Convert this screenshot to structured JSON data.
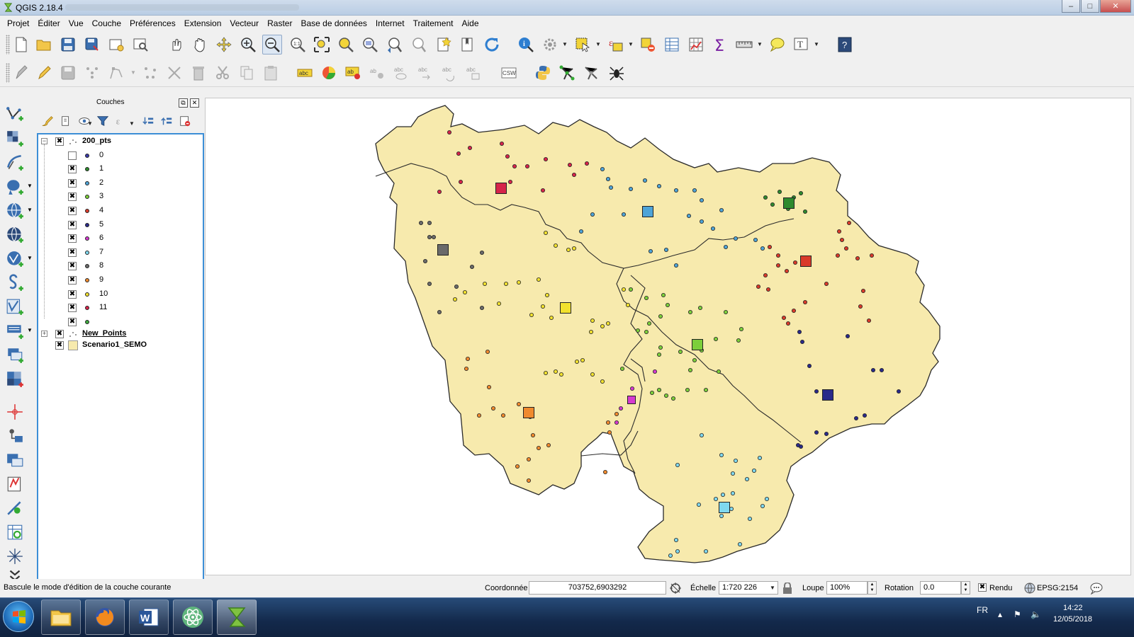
{
  "window": {
    "title": "QGIS 2.18.4",
    "min_label": "–",
    "max_label": "□",
    "close_label": "✕"
  },
  "menu": [
    "Projet",
    "Éditer",
    "Vue",
    "Couche",
    "Préférences",
    "Extension",
    "Vecteur",
    "Raster",
    "Base de données",
    "Internet",
    "Traitement",
    "Aide"
  ],
  "toolbar1": [
    "new-project-icon",
    "open-project-icon",
    "save-project-icon",
    "save-as-icon",
    "new-print-composer-icon",
    "composer-manager-icon",
    "touch-pan-icon",
    "pan-icon",
    "pan-to-selection-icon",
    "zoom-in-icon",
    "zoom-out-icon",
    "zoom-native-icon",
    "zoom-full-icon",
    "zoom-to-selection-icon",
    "zoom-to-layer-icon",
    "zoom-last-icon",
    "zoom-next-icon",
    "new-bookmark-icon",
    "show-bookmarks-icon",
    "refresh-icon",
    "identify-icon",
    "run-action-icon",
    "select-features-icon",
    "select-by-expression-icon",
    "deselect-icon",
    "attribute-table-icon",
    "field-calculator-icon",
    "statistics-icon",
    "measure-icon",
    "map-tips-icon",
    "text-annotation-icon",
    "help-icon"
  ],
  "toolbar2": [
    "current-edits-icon",
    "toggle-editing-icon",
    "save-edits-icon",
    "add-feature-icon",
    "node-tool-icon",
    "add-point-icon",
    "move-feature-icon",
    "delete-selected-icon",
    "cut-features-icon",
    "copy-features-icon",
    "paste-features-icon",
    "layer-labeling-icon",
    "layer-diagram-icon",
    "pin-labels-icon",
    "highlight-pinned-labels-icon",
    "show-hide-labels-icon",
    "move-label-icon",
    "rotate-label-icon",
    "change-label-icon",
    "csw-icon",
    "python-console-icon",
    "topology-checker-icon",
    "georeferencer-icon",
    "gps-tools-icon"
  ],
  "left_toolbar": [
    "add-vector-layer-icon",
    "add-raster-layer-icon",
    "add-delimited-text-icon",
    "add-postgis-layer-icon",
    "add-wms-layer-icon",
    "add-wcs-layer-icon",
    "add-wfs-layer-icon",
    "add-spatialite-layer-icon",
    "new-shapefile-icon",
    "add-virtual-layer-icon",
    "add-mssql-layer-icon",
    "add-oracle-layer-icon",
    "add-db2-layer-icon",
    "add-db-manager-icon",
    "new-temporary-layer-icon",
    "georeference-icon",
    "add-delimited-icon",
    "more-tools-icon"
  ],
  "layers_panel": {
    "title": "Couches",
    "tools": [
      "style-icon",
      "add-group-icon",
      "visibility-icon",
      "filter-legend-icon",
      "filter-expression-icon",
      "expand-all-icon",
      "collapse-all-icon",
      "remove-layer-icon"
    ],
    "layers": [
      {
        "name": "200_pts",
        "expanded": true,
        "checked": true,
        "classes": [
          {
            "label": "0",
            "color": "#3a3aa8",
            "checked": false
          },
          {
            "label": "1",
            "color": "#2e8a2e",
            "checked": true
          },
          {
            "label": "2",
            "color": "#4ea4d8",
            "checked": true
          },
          {
            "label": "3",
            "color": "#7ccf3a",
            "checked": true
          },
          {
            "label": "4",
            "color": "#d93a2a",
            "checked": true
          },
          {
            "label": "5",
            "color": "#2a2a8a",
            "checked": true
          },
          {
            "label": "6",
            "color": "#d63ad0",
            "checked": true
          },
          {
            "label": "7",
            "color": "#7fd8ef",
            "checked": true
          },
          {
            "label": "8",
            "color": "#6a6a6a",
            "checked": true
          },
          {
            "label": "9",
            "color": "#f08a2e",
            "checked": true
          },
          {
            "label": "10",
            "color": "#f2e12e",
            "checked": true
          },
          {
            "label": "11",
            "color": "#d6244a",
            "checked": true
          },
          {
            "label": "",
            "color": "#3caa3c",
            "checked": true
          }
        ]
      },
      {
        "name": "New_Points",
        "expanded": false,
        "checked": true
      },
      {
        "name": "Scenario1_SEMO",
        "expanded": false,
        "checked": true,
        "fill": "#f7eaad"
      }
    ]
  },
  "map": {
    "background": "#ffffff",
    "polygon_fill": "#f7eaad",
    "outline": "#2a2a2a",
    "centroids": [
      {
        "class": "11",
        "color": "#d6244a"
      },
      {
        "class": "2",
        "color": "#4ea4d8"
      },
      {
        "class": "1",
        "color": "#2e8a2e"
      },
      {
        "class": "8",
        "color": "#6a6a6a"
      },
      {
        "class": "4",
        "color": "#d93a2a"
      },
      {
        "class": "10",
        "color": "#f2e12e"
      },
      {
        "class": "3",
        "color": "#7ccf3a"
      },
      {
        "class": "5",
        "color": "#2a2a8a"
      },
      {
        "class": "6",
        "color": "#d63ad0"
      },
      {
        "class": "9",
        "color": "#f08a2e"
      },
      {
        "class": "7",
        "color": "#7fd8ef"
      }
    ]
  },
  "status": {
    "message": "Bascule le mode d'édition de la couche courante",
    "coord_label": "Coordonnée",
    "coord_value": "703752,6903292",
    "scale_label": "Échelle",
    "scale_value": "1:720 226",
    "magnifier_label": "Loupe",
    "magnifier_value": "100%",
    "rotation_label": "Rotation",
    "rotation_value": "0.0",
    "render_label": "Rendu",
    "render_checked": true,
    "crs": "EPSG:2154"
  },
  "taskbar": {
    "apps": [
      "explorer-icon",
      "firefox-icon",
      "word-icon",
      "atom-icon",
      "qgis-icon"
    ],
    "lang": "FR",
    "time": "14:22",
    "date": "12/05/2018"
  }
}
